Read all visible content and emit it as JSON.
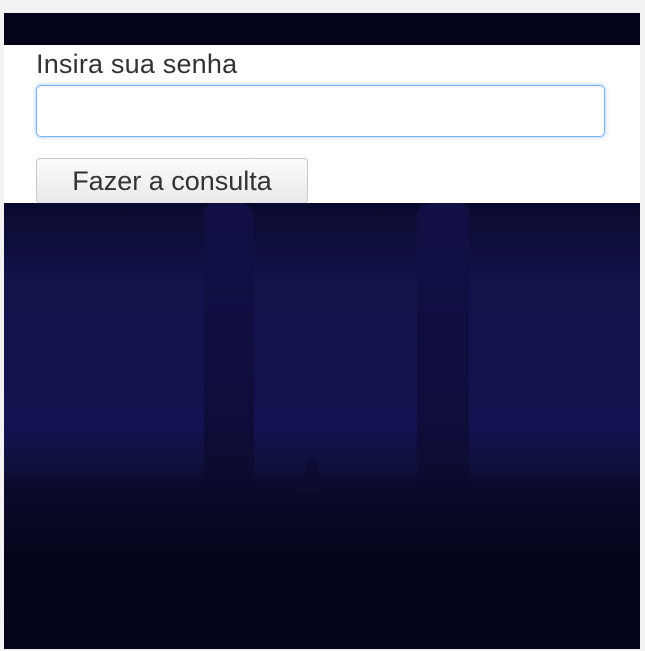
{
  "form": {
    "password_label": "Insira sua senha",
    "password_value": "",
    "submit_label": "Fazer a consulta"
  },
  "colors": {
    "top_bar": "#03031a",
    "panel": "#ffffff",
    "input_focus_border": "#7fb3f0",
    "background_sky": "#141250",
    "background_ground": "#03041a"
  }
}
